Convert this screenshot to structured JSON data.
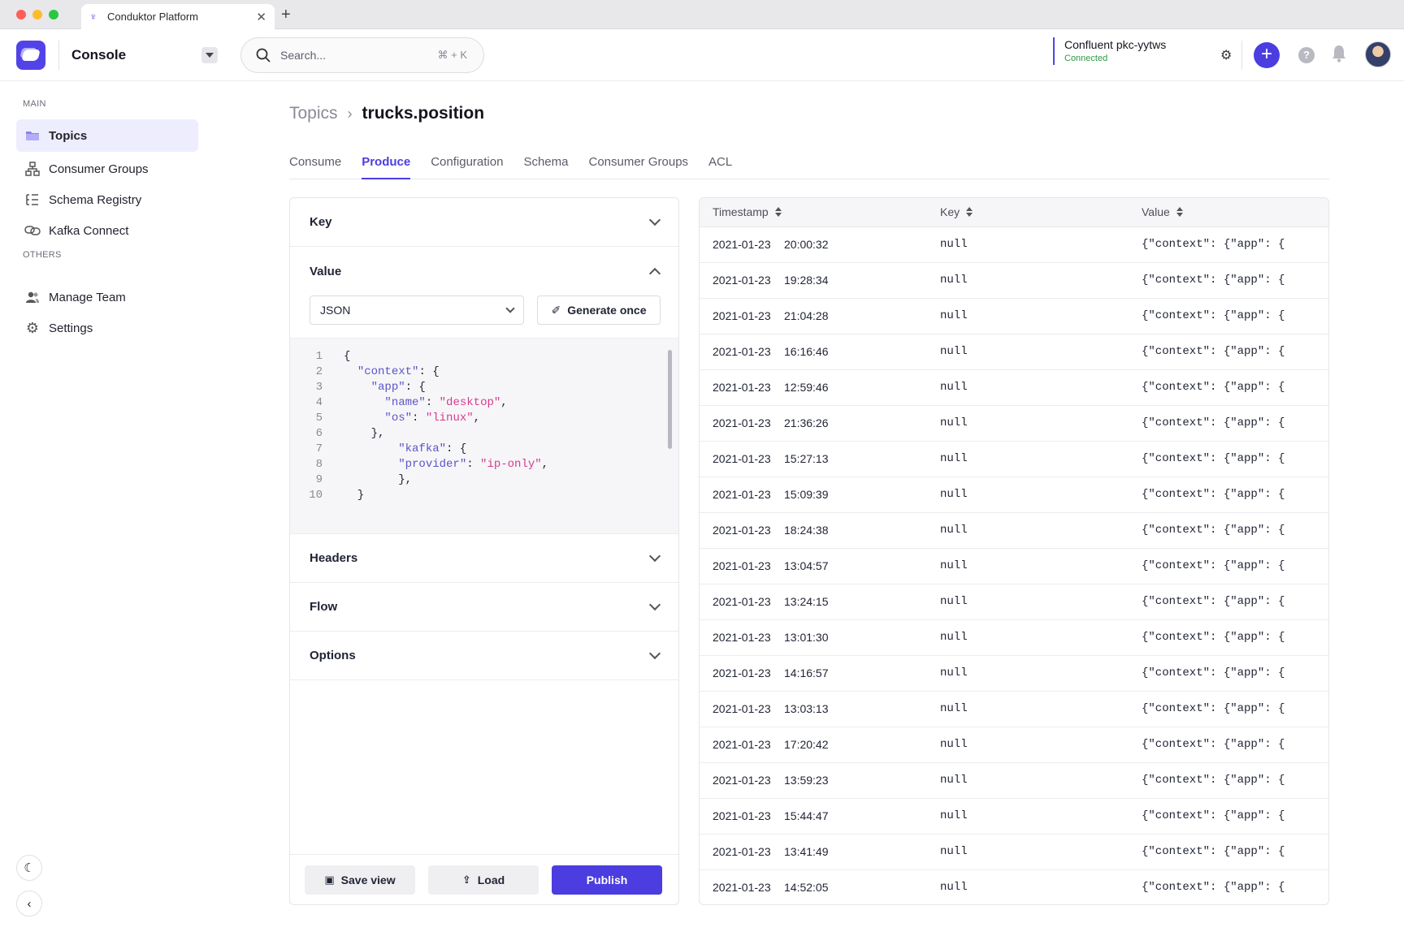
{
  "browser": {
    "tab_title": "Conduktor Platform",
    "traffic": [
      "#ff5f57",
      "#febc2e",
      "#28c840"
    ]
  },
  "header": {
    "app_title": "Console",
    "search_placeholder": "Search...",
    "search_shortcut": "⌘ + K",
    "cluster_name": "Confluent pkc-yytws",
    "cluster_status": "Connected",
    "accent_color": "#4b3de0"
  },
  "sidebar": {
    "section_main": "MAIN",
    "section_others": "OTHERS",
    "items": [
      {
        "label": "Topics",
        "icon": "folder-icon",
        "active": true
      },
      {
        "label": "Consumer Groups",
        "icon": "hierarchy-icon"
      },
      {
        "label": "Schema Registry",
        "icon": "schema-icon"
      },
      {
        "label": "Kafka Connect",
        "icon": "link-icon"
      },
      {
        "label": "Manage Team",
        "icon": "users-icon"
      },
      {
        "label": "Settings",
        "icon": "gear-icon"
      }
    ]
  },
  "breadcrumb": {
    "parent": "Topics",
    "current": "trucks.position"
  },
  "tabs": [
    "Consume",
    "Produce",
    "Configuration",
    "Schema",
    "Consumer Groups",
    "ACL"
  ],
  "active_tab": "Produce",
  "produce": {
    "key_label": "Key",
    "value_label": "Value",
    "format": "JSON",
    "generate_label": "Generate once",
    "headers_label": "Headers",
    "flow_label": "Flow",
    "options_label": "Options",
    "save_label": "Save view",
    "load_label": "Load",
    "publish_label": "Publish",
    "code_lines": [
      "{",
      "  \"context\": {",
      "    \"app\": {",
      "      \"name\": \"desktop\",",
      "      \"os\": \"linux\",",
      "    },",
      "        \"kafka\": {",
      "        \"provider\": \"ip-only\",",
      "        },",
      "  }"
    ]
  },
  "table": {
    "columns": [
      "Timestamp",
      "Key",
      "Value"
    ],
    "rows": [
      {
        "date": "2021-01-23",
        "time": "20:00:32",
        "key": "null",
        "value": "{\"context\": {\"app\": {"
      },
      {
        "date": "2021-01-23",
        "time": "19:28:34",
        "key": "null",
        "value": "{\"context\": {\"app\": {"
      },
      {
        "date": "2021-01-23",
        "time": "21:04:28",
        "key": "null",
        "value": "{\"context\": {\"app\": {"
      },
      {
        "date": "2021-01-23",
        "time": "16:16:46",
        "key": "null",
        "value": "{\"context\": {\"app\": {"
      },
      {
        "date": "2021-01-23",
        "time": "12:59:46",
        "key": "null",
        "value": "{\"context\": {\"app\": {"
      },
      {
        "date": "2021-01-23",
        "time": "21:36:26",
        "key": "null",
        "value": "{\"context\": {\"app\": {"
      },
      {
        "date": "2021-01-23",
        "time": "15:27:13",
        "key": "null",
        "value": "{\"context\": {\"app\": {"
      },
      {
        "date": "2021-01-23",
        "time": "15:09:39",
        "key": "null",
        "value": "{\"context\": {\"app\": {"
      },
      {
        "date": "2021-01-23",
        "time": "18:24:38",
        "key": "null",
        "value": "{\"context\": {\"app\": {"
      },
      {
        "date": "2021-01-23",
        "time": "13:04:57",
        "key": "null",
        "value": "{\"context\": {\"app\": {"
      },
      {
        "date": "2021-01-23",
        "time": "13:24:15",
        "key": "null",
        "value": "{\"context\": {\"app\": {"
      },
      {
        "date": "2021-01-23",
        "time": "13:01:30",
        "key": "null",
        "value": "{\"context\": {\"app\": {"
      },
      {
        "date": "2021-01-23",
        "time": "14:16:57",
        "key": "null",
        "value": "{\"context\": {\"app\": {"
      },
      {
        "date": "2021-01-23",
        "time": "13:03:13",
        "key": "null",
        "value": "{\"context\": {\"app\": {"
      },
      {
        "date": "2021-01-23",
        "time": "17:20:42",
        "key": "null",
        "value": "{\"context\": {\"app\": {"
      },
      {
        "date": "2021-01-23",
        "time": "13:59:23",
        "key": "null",
        "value": "{\"context\": {\"app\": {"
      },
      {
        "date": "2021-01-23",
        "time": "15:44:47",
        "key": "null",
        "value": "{\"context\": {\"app\": {"
      },
      {
        "date": "2021-01-23",
        "time": "13:41:49",
        "key": "null",
        "value": "{\"context\": {\"app\": {"
      },
      {
        "date": "2021-01-23",
        "time": "14:52:05",
        "key": "null",
        "value": "{\"context\": {\"app\": {"
      }
    ]
  }
}
